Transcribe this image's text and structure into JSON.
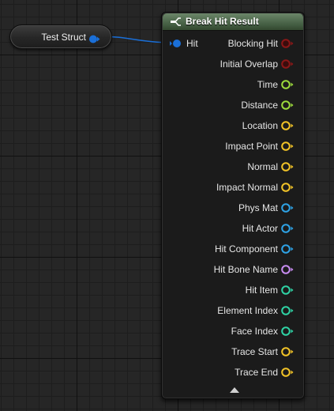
{
  "variable_node": {
    "label": "Test Struct"
  },
  "node": {
    "title": "Break Hit Result",
    "input_pin": {
      "label": "Hit"
    },
    "output_pins": [
      {
        "label": "Blocking Hit",
        "color": "#8c1717"
      },
      {
        "label": "Initial Overlap",
        "color": "#8c1717"
      },
      {
        "label": "Time",
        "color": "#9cdb3c"
      },
      {
        "label": "Distance",
        "color": "#9cdb3c"
      },
      {
        "label": "Location",
        "color": "#f2c327"
      },
      {
        "label": "Impact Point",
        "color": "#f2c327"
      },
      {
        "label": "Normal",
        "color": "#f2c327"
      },
      {
        "label": "Impact Normal",
        "color": "#f2c327"
      },
      {
        "label": "Phys Mat",
        "color": "#2ea3e6"
      },
      {
        "label": "Hit Actor",
        "color": "#2ea3e6"
      },
      {
        "label": "Hit Component",
        "color": "#2ea3e6"
      },
      {
        "label": "Hit Bone Name",
        "color": "#c88cf2"
      },
      {
        "label": "Hit Item",
        "color": "#2fd3a5"
      },
      {
        "label": "Element Index",
        "color": "#2fd3a5"
      },
      {
        "label": "Face Index",
        "color": "#2fd3a5"
      },
      {
        "label": "Trace Start",
        "color": "#f2c327"
      },
      {
        "label": "Trace End",
        "color": "#f2c327"
      }
    ],
    "expand_icon": "chevron-up-icon"
  },
  "colors": {
    "struct_pin": "#1a6fd8",
    "header": "#4f6b4d",
    "wire": "#1a6fd8"
  }
}
